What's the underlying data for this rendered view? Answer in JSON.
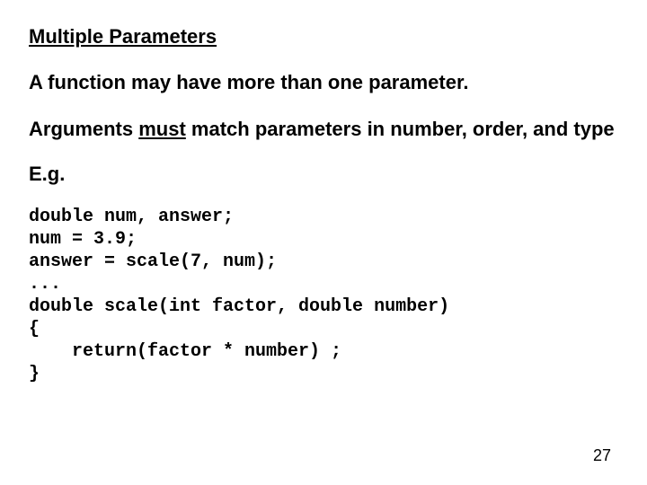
{
  "title": "Multiple Parameters",
  "para1": "A function may have more than one parameter.",
  "para2_pre": "Arguments ",
  "para2_u": "must",
  "para2_post": " match parameters in number, order, and type",
  "eg": "E.g.",
  "code": "double num, answer;\nnum = 3.9;\nanswer = scale(7, num);\n...\ndouble scale(int factor, double number)\n{\n    return(factor * number) ;\n}",
  "page": "27"
}
